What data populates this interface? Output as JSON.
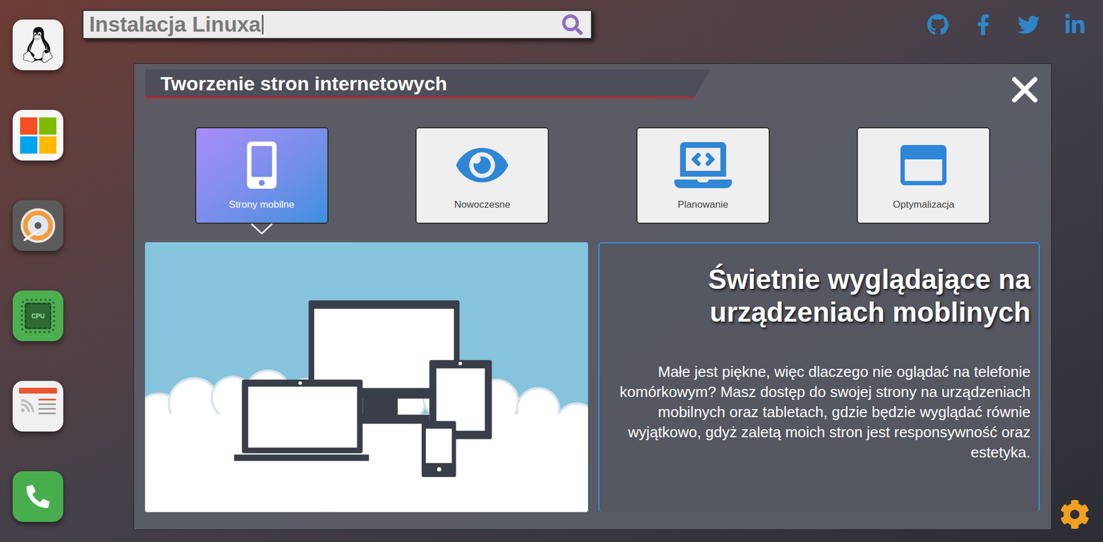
{
  "search": {
    "value": "Instalacja Linuxa",
    "caret": true
  },
  "dock": [
    {
      "kind": "linux"
    },
    {
      "kind": "windows"
    },
    {
      "kind": "disk"
    },
    {
      "kind": "cpu",
      "badge": "CPU"
    },
    {
      "kind": "rss"
    },
    {
      "kind": "phone"
    }
  ],
  "social": [
    {
      "kind": "github"
    },
    {
      "kind": "facebook"
    },
    {
      "kind": "twitter"
    },
    {
      "kind": "linkedin"
    }
  ],
  "window": {
    "title": "Tworzenie stron internetowych"
  },
  "tabs": [
    {
      "label": "Strony mobilne",
      "kind": "mobile",
      "selected": true
    },
    {
      "label": "Nowoczesne",
      "kind": "eye",
      "selected": false
    },
    {
      "label": "Planowanie",
      "kind": "laptop",
      "selected": false
    },
    {
      "label": "Optymalizacja",
      "kind": "window",
      "selected": false
    }
  ],
  "content": {
    "heading": "Świetnie wyglądające na urządzeniach moblinych",
    "body": "Małe jest piękne, więc dlaczego nie oglądać na telefonie komórkowym? Masz dostęp do swojej strony na urządzeniach mobilnych oraz tabletach, gdzie będzie wyglądać równie wyjątkowo, gdyż zaletą moich stron jest responsywność oraz estetyka."
  }
}
